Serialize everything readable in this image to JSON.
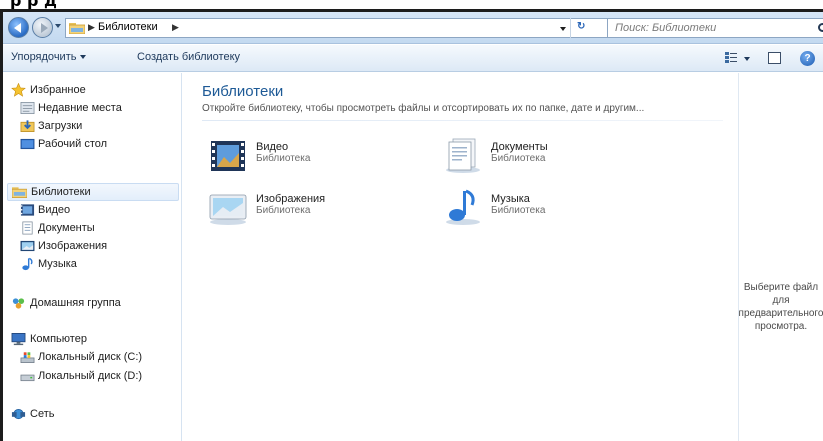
{
  "header_fragment": "р  р    д",
  "address": {
    "path": "Библиотеки",
    "search_placeholder": "Поиск: Библиотеки"
  },
  "toolbar": {
    "organize": "Упорядочить",
    "create_library": "Создать библиотеку"
  },
  "sidebar": {
    "favorites": {
      "label": "Избранное",
      "items": [
        "Недавние места",
        "Загрузки",
        "Рабочий стол"
      ]
    },
    "libraries": {
      "label": "Библиотеки",
      "items": [
        "Видео",
        "Документы",
        "Изображения",
        "Музыка"
      ]
    },
    "homegroup": "Домашняя группа",
    "computer": {
      "label": "Компьютер",
      "items": [
        "Локальный диск (C:)",
        "Локальный диск (D:)"
      ]
    },
    "network": "Сеть"
  },
  "content": {
    "title": "Библиотеки",
    "subtitle": "Откройте библиотеку, чтобы просмотреть файлы и отсортировать их по папке, дате и другим...",
    "libraries": [
      {
        "name": "Видео",
        "type": "Библиотека",
        "icon": "video-library-icon"
      },
      {
        "name": "Документы",
        "type": "Библиотека",
        "icon": "documents-library-icon"
      },
      {
        "name": "Изображения",
        "type": "Библиотека",
        "icon": "pictures-library-icon"
      },
      {
        "name": "Музыка",
        "type": "Библиотека",
        "icon": "music-library-icon"
      }
    ]
  },
  "preview": {
    "lines": [
      "Выберите файл",
      "для",
      "предварительного",
      "просмотра."
    ]
  },
  "colors": {
    "accent_title": "#1e5a96",
    "toolbar_text": "#1e395b",
    "selected_bg": "#e3eefb"
  }
}
